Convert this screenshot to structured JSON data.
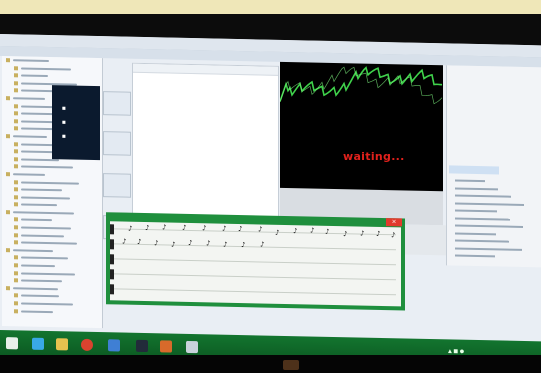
{
  "plot": {
    "status_text": "waiting..."
  },
  "icons": {
    "start": "windows-start-icon",
    "ie": "internet-explorer-icon",
    "explorer": "file-explorer-icon",
    "chrome": "chrome-icon",
    "store": "store-icon",
    "app1": "app-icon",
    "app2": "app-icon",
    "close": "close-icon"
  },
  "colors": {
    "taskbar": "#137530",
    "dialog_frame": "#1f8f3d",
    "signal": "#3fd24b",
    "status": "#e0211c"
  }
}
